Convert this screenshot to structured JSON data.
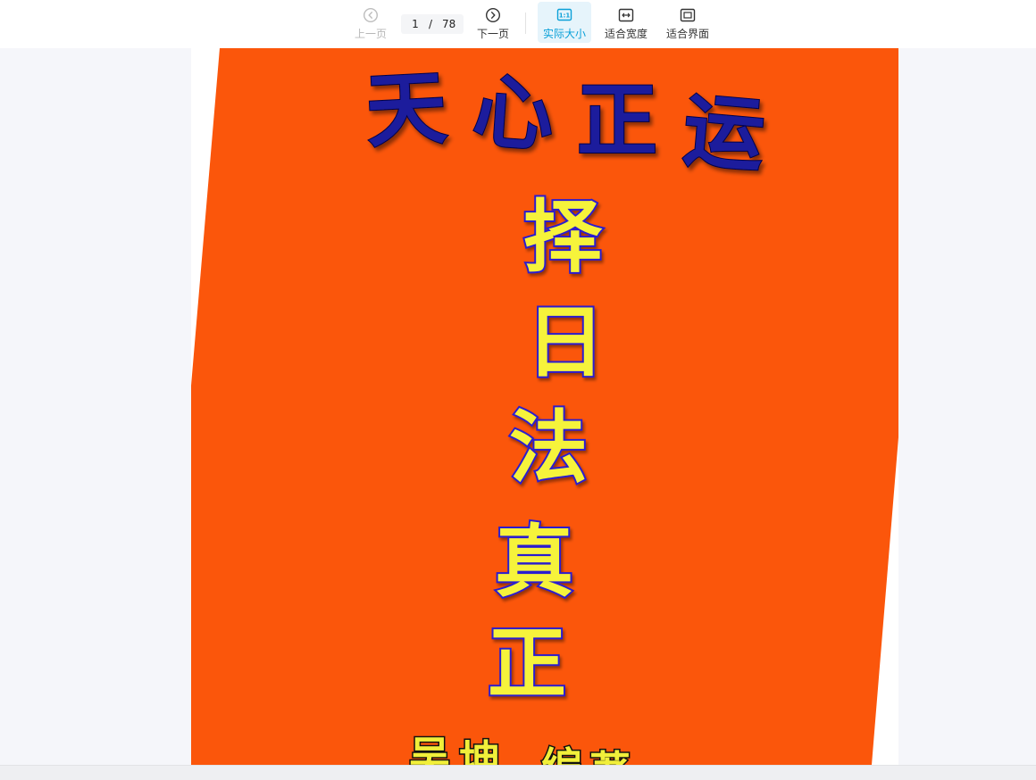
{
  "toolbar": {
    "prev_label": "上一页",
    "next_label": "下一页",
    "current_page": "1",
    "separator": "/",
    "total_pages": "78",
    "actual_size_label": "实际大小",
    "actual_size_icon_text": "1:1",
    "fit_width_label": "适合宽度",
    "fit_page_label": "适合界面",
    "icons": {
      "prev": "chevron-left-circle-icon",
      "next": "chevron-right-circle-icon",
      "actual_size": "one-to-one-icon",
      "fit_width": "fit-width-icon",
      "fit_page": "fit-page-icon"
    },
    "active_color": "#0aa0d8",
    "active_bg": "#e6f4fb"
  },
  "document": {
    "cover": {
      "background_color": "#fb560b",
      "title": [
        "天",
        "心",
        "正",
        "运"
      ],
      "vertical_title": [
        "择",
        "日",
        "法",
        "真",
        "正"
      ],
      "author_line": [
        "吴",
        "坤",
        "编",
        "著"
      ]
    }
  }
}
